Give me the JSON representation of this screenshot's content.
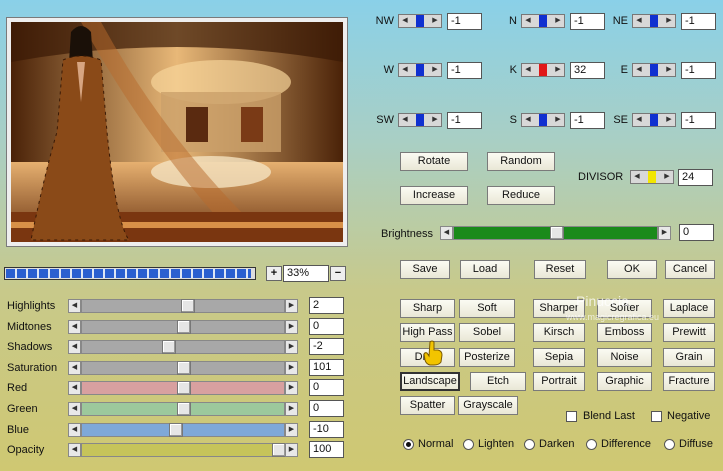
{
  "zoom": {
    "plus": "+",
    "value": "33%",
    "minus": "−",
    "progress": 0.988
  },
  "adjust": [
    {
      "label": "Highlights",
      "value": "2",
      "pos": 0.52,
      "color": "#a8a8a8"
    },
    {
      "label": "Midtones",
      "value": "0",
      "pos": 0.5,
      "color": "#a8a8a8"
    },
    {
      "label": "Shadows",
      "value": "-2",
      "pos": 0.42,
      "color": "#a8a8a8"
    },
    {
      "label": "Saturation",
      "value": "101",
      "pos": 0.5,
      "color": "#a8a8a8"
    },
    {
      "label": "Red",
      "value": "0",
      "pos": 0.5,
      "color": "#d8a0a0"
    },
    {
      "label": "Green",
      "value": "0",
      "pos": 0.5,
      "color": "#9cc89c"
    },
    {
      "label": "Blue",
      "value": "-10",
      "pos": 0.46,
      "color": "#7fa8d8"
    },
    {
      "label": "Opacity",
      "value": "100",
      "pos": 1.0,
      "color": "#c6c45a"
    }
  ],
  "matrix": [
    {
      "label": "NW",
      "value": "-1",
      "thumb": "#1030d0"
    },
    {
      "label": "N",
      "value": "-1",
      "thumb": "#1030d0"
    },
    {
      "label": "NE",
      "value": "-1",
      "thumb": "#1030d0"
    },
    {
      "label": "W",
      "value": "-1",
      "thumb": "#1030d0"
    },
    {
      "label": "K",
      "value": "32",
      "thumb": "#e01818"
    },
    {
      "label": "E",
      "value": "-1",
      "thumb": "#1030d0"
    },
    {
      "label": "SW",
      "value": "-1",
      "thumb": "#1030d0"
    },
    {
      "label": "S",
      "value": "-1",
      "thumb": "#1030d0"
    },
    {
      "label": "SE",
      "value": "-1",
      "thumb": "#1030d0"
    }
  ],
  "ops": {
    "rotate": "Rotate",
    "random": "Random",
    "increase": "Increase",
    "reduce": "Reduce"
  },
  "divisor": {
    "label": "DIVISOR",
    "value": "24",
    "thumb": "#f2e600"
  },
  "brightness": {
    "label": "Brightness",
    "value": "0",
    "pos": 0.5,
    "color": "#1a8a1a"
  },
  "actions": {
    "save": "Save",
    "load": "Load",
    "reset": "Reset",
    "ok": "OK",
    "cancel": "Cancel"
  },
  "presets": [
    [
      "Sharp",
      "Soft",
      "Sharper",
      "Softer",
      "Laplace"
    ],
    [
      "High Pass",
      "Sobel",
      "Kirsch",
      "Emboss",
      "Prewitt"
    ],
    [
      "Draw",
      "Posterize",
      "Sepia",
      "Noise",
      "Grain"
    ],
    [
      "Landscape",
      "Etch",
      "Portrait",
      "Graphic",
      "Fracture"
    ],
    [
      "Spatter",
      "Grayscale"
    ]
  ],
  "checks": {
    "blend_last": "Blend Last",
    "negative": "Negative"
  },
  "modes": [
    "Normal",
    "Lighten",
    "Darken",
    "Difference",
    "Diffuse"
  ],
  "watermark": {
    "line1": "Pinuccia",
    "line2": "www.magicregrafica.eu"
  }
}
